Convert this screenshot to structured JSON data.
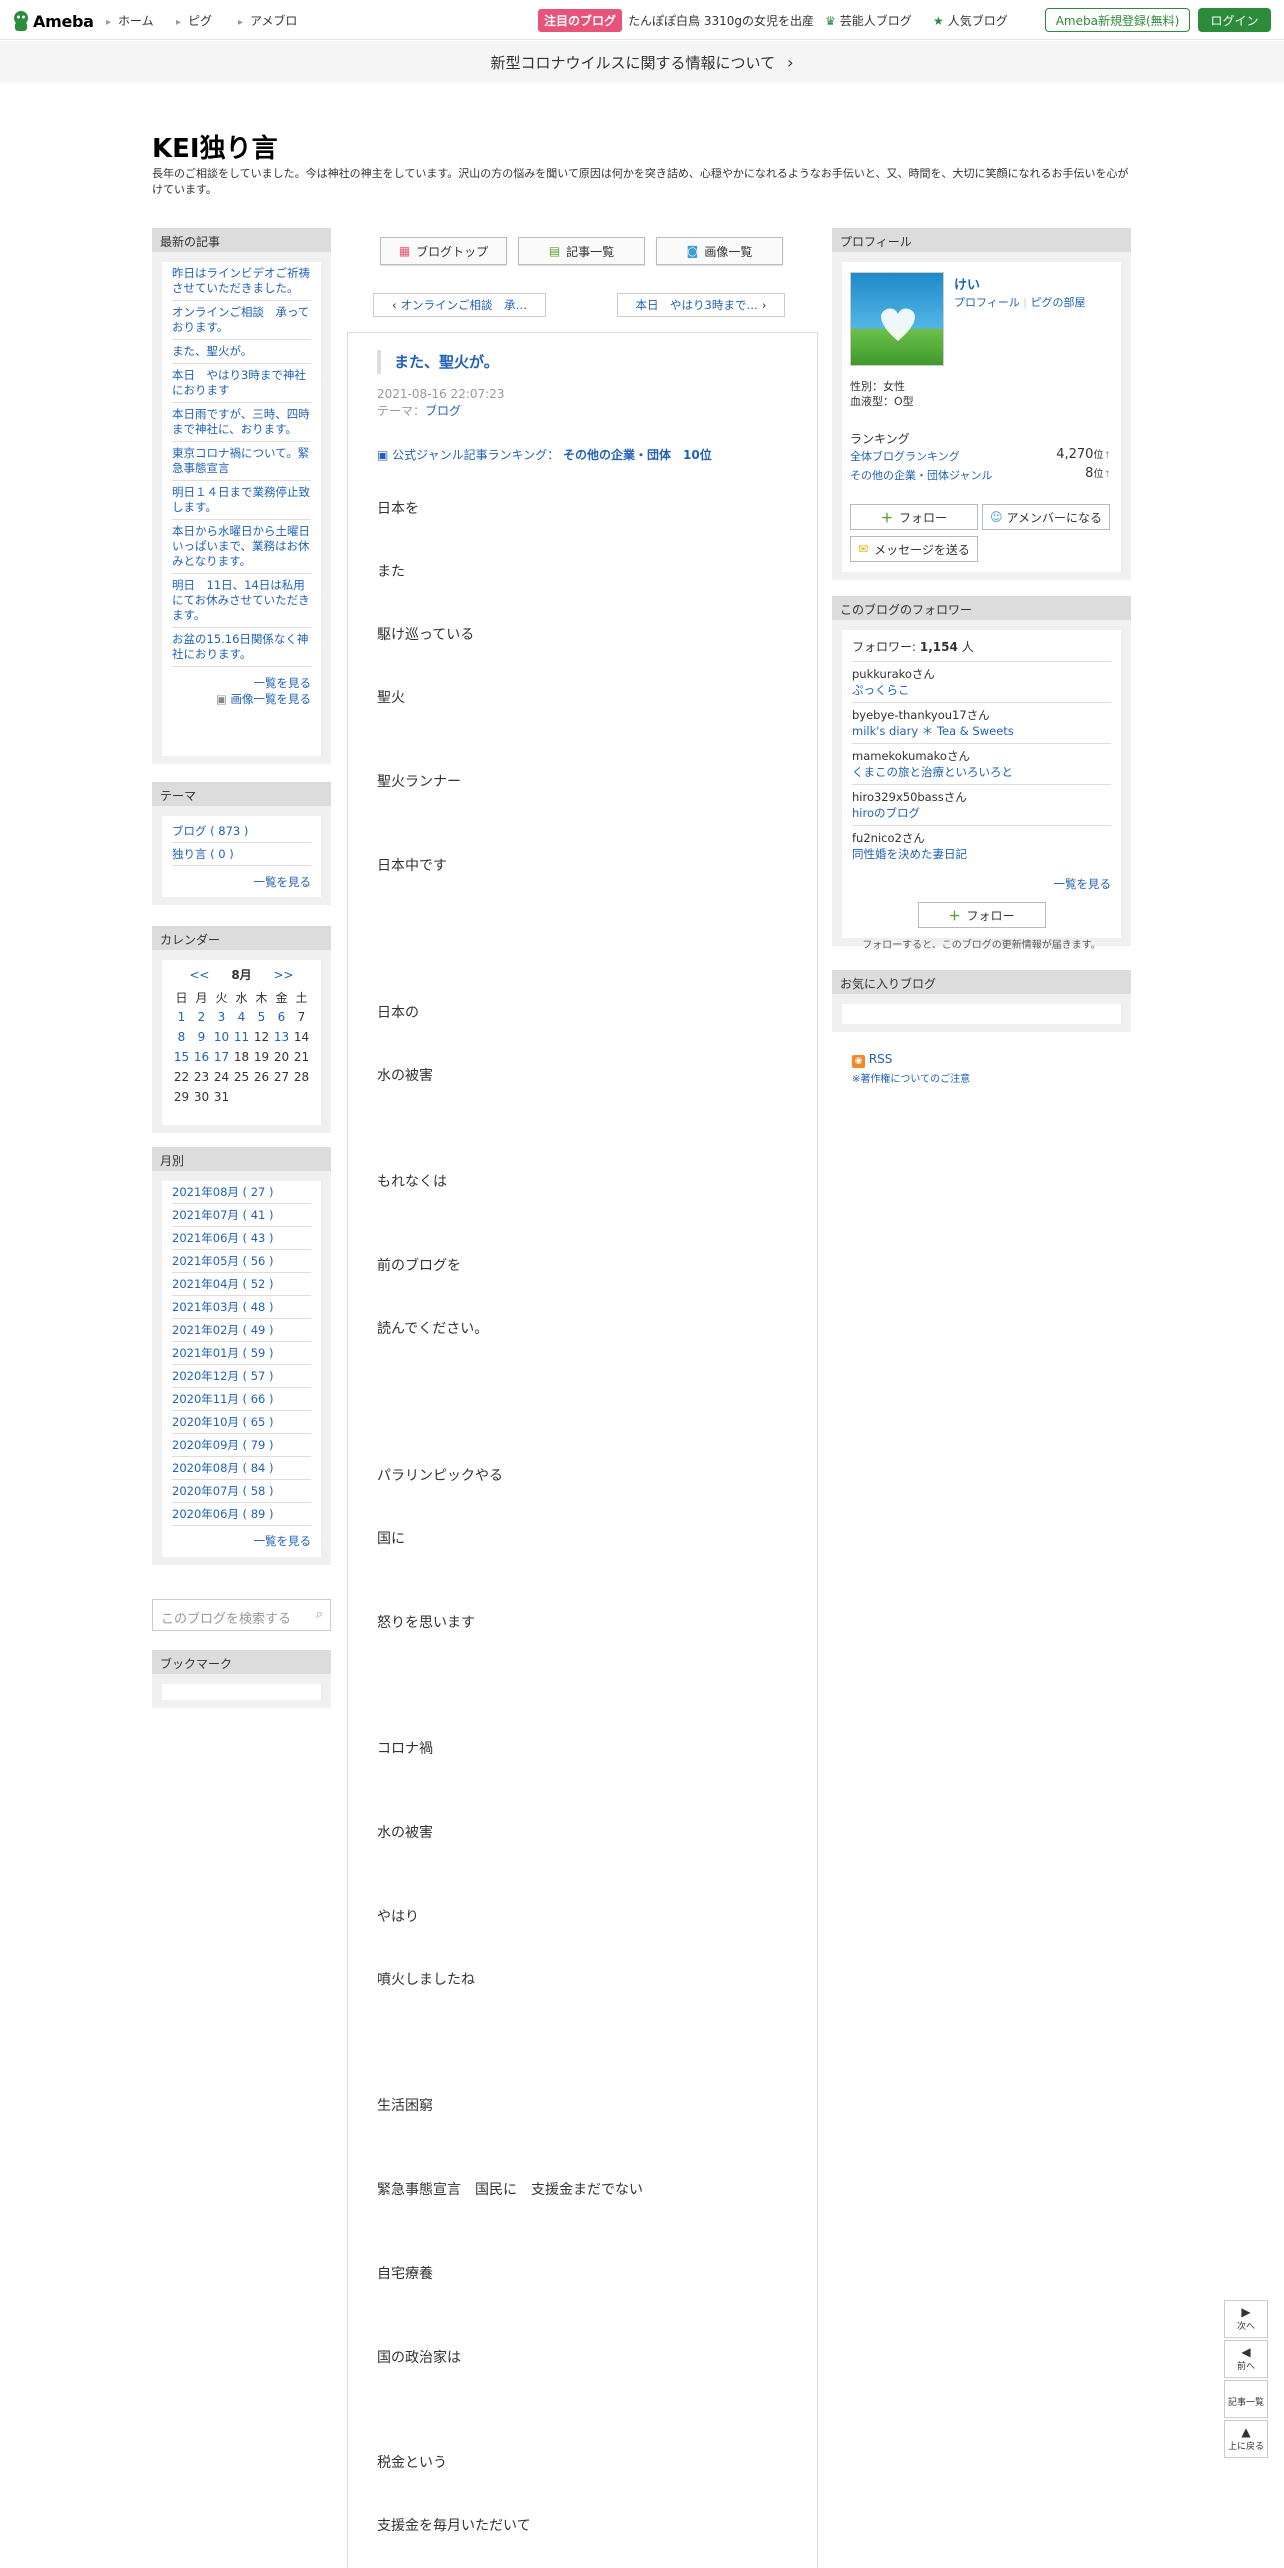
{
  "header": {
    "logo": "Ameba",
    "nav": [
      "ホーム",
      "ピグ",
      "アメブロ"
    ],
    "pickup_badge": "注目のブログ",
    "pickup_text": "たんぽぽ白鳥 3310gの女児を出産",
    "celeb_link": "芸能人ブログ",
    "popular_link": "人気ブログ",
    "register": "Ameba新規登録(無料)",
    "login": "ログイン"
  },
  "notice": "新型コロナウイルスに関する情報について",
  "blog": {
    "title": "KEI独り言",
    "description": "長年のご相談をしていました。今は神社の神主をしています。沢山の方の悩みを聞いて原因は何かを突き詰め、心穏やかになれるようなお手伝いと、又、時間を、大切に笑顔になれるお手伝いを心がけています。"
  },
  "left": {
    "recent_header": "最新の記事",
    "recent": [
      "昨日はラインビデオご祈祷させていただきました。",
      "オンラインご相談　承っております。",
      "また、聖火が。",
      "本日　やはり3時まで神社におります",
      "本日雨ですが、三時、四時まで神社に、おります。",
      "東京コロナ禍について。緊急事態宣言",
      "明日１４日まで業務停止致します。",
      "本日から水曜日から土曜日いっぱいまで、業務はお休みとなります。",
      "明日　11日、14日は私用にてお休みさせていただきます。",
      "お盆の15.16日関係なく神社におります。"
    ],
    "recent_more": "一覧を見る",
    "image_more": "画像一覧を見る",
    "theme_header": "テーマ",
    "themes": [
      "ブログ ( 873 )",
      "独り言 ( 0 )"
    ],
    "theme_more": "一覧を見る",
    "calendar_header": "カレンダー",
    "calendar": {
      "prev": "<<",
      "month": "8月",
      "next": ">>",
      "weekdays": [
        "日",
        "月",
        "火",
        "水",
        "木",
        "金",
        "土"
      ],
      "weeks": [
        [
          "1",
          "2",
          "3",
          "4",
          "5",
          "6",
          "7"
        ],
        [
          "8",
          "9",
          "10",
          "11",
          "12",
          "13",
          "14"
        ],
        [
          "15",
          "16",
          "17",
          "18",
          "19",
          "20",
          "21"
        ],
        [
          "22",
          "23",
          "24",
          "25",
          "26",
          "27",
          "28"
        ],
        [
          "29",
          "30",
          "31",
          "",
          "",
          "",
          ""
        ]
      ],
      "linked": [
        "1",
        "2",
        "3",
        "4",
        "5",
        "6",
        "8",
        "9",
        "10",
        "11",
        "13",
        "15",
        "16",
        "17"
      ]
    },
    "monthly_header": "月別",
    "months": [
      "2021年08月 ( 27 )",
      "2021年07月 ( 41 )",
      "2021年06月 ( 43 )",
      "2021年05月 ( 56 )",
      "2021年04月 ( 52 )",
      "2021年03月 ( 48 )",
      "2021年02月 ( 49 )",
      "2021年01月 ( 59 )",
      "2020年12月 ( 57 )",
      "2020年11月 ( 66 )",
      "2020年10月 ( 65 )",
      "2020年09月 ( 79 )",
      "2020年08月 ( 84 )",
      "2020年07月 ( 58 )",
      "2020年06月 ( 89 )"
    ],
    "monthly_more": "一覧を見る",
    "search_placeholder": "このブログを検索する",
    "bookmark_header": "ブックマーク"
  },
  "center": {
    "top_buttons": [
      "ブログトップ",
      "記事一覧",
      "画像一覧"
    ],
    "prev_entry": "オンラインご相談　承…",
    "next_entry": "本日　やはり3時まで…",
    "entry_title": "また、聖火が。",
    "entry_date": "2021-08-16 22:07:23",
    "theme_label": "テーマ：",
    "theme_value": "ブログ",
    "rank_label": "公式ジャンル記事ランキング：",
    "rank_value": "その他の企業・団体　10位",
    "body": [
      "日本を",
      "また",
      "駆け巡っている",
      "聖火",
      "聖火ランナー",
      "日本中です",
      "日本の",
      "水の被害",
      "もれなくは",
      "前のブログを",
      "読んでください。",
      "パラリンピックやる",
      "国に",
      "怒りを思います",
      "コロナ禍",
      "水の被害",
      "やはり",
      "噴火しましたね",
      "生活困窮",
      "緊急事態宣言　国民に　支援金まだでない",
      "自宅療養",
      "国の政治家は",
      "税金という",
      "支援金を毎月いただいて"
    ]
  },
  "right": {
    "profile_header": "プロフィール",
    "name": "けい",
    "profile_link": "プロフィール",
    "pig_link": "ピグの部屋",
    "gender": "性別：女性",
    "blood": "血液型：O型",
    "ranking_label": "ランキング",
    "rank1_label": "全体ブログランキング",
    "rank1_value": "4,270",
    "rank2_label": "その他の企業・団体ジャンル",
    "rank2_value": "8",
    "rank_unit": "位",
    "follow_btn": "フォロー",
    "member_btn": "アメンバーになる",
    "message_btn": "メッセージを送る",
    "followers_header": "このブログのフォロワー",
    "followers_label": "フォロワー:",
    "followers_count": "1,154",
    "followers_unit": "人",
    "followers": [
      {
        "user": "pukkurakoさん",
        "blog": "ぷっくらこ"
      },
      {
        "user": "byebye-thankyou17さん",
        "blog": "milk's diary ＊ Tea & Sweets"
      },
      {
        "user": "mamekokumakoさん",
        "blog": "くまこの旅と治療といろいろと"
      },
      {
        "user": "hiro329x50bassさん",
        "blog": "hiroのブログ"
      },
      {
        "user": "fu2nico2さん",
        "blog": "同性婚を決めた妻日記"
      }
    ],
    "followers_more": "一覧を見る",
    "follow_btn2": "フォロー",
    "follow_note": "フォローすると、このブログの更新情報が届きます。",
    "favorites_header": "お気に入りブログ",
    "rss": "RSS",
    "copyright": "※著作権についてのご注意"
  },
  "floating": {
    "next": "次へ",
    "prev": "前へ",
    "list": "記事一覧",
    "top": "上に戻る"
  }
}
